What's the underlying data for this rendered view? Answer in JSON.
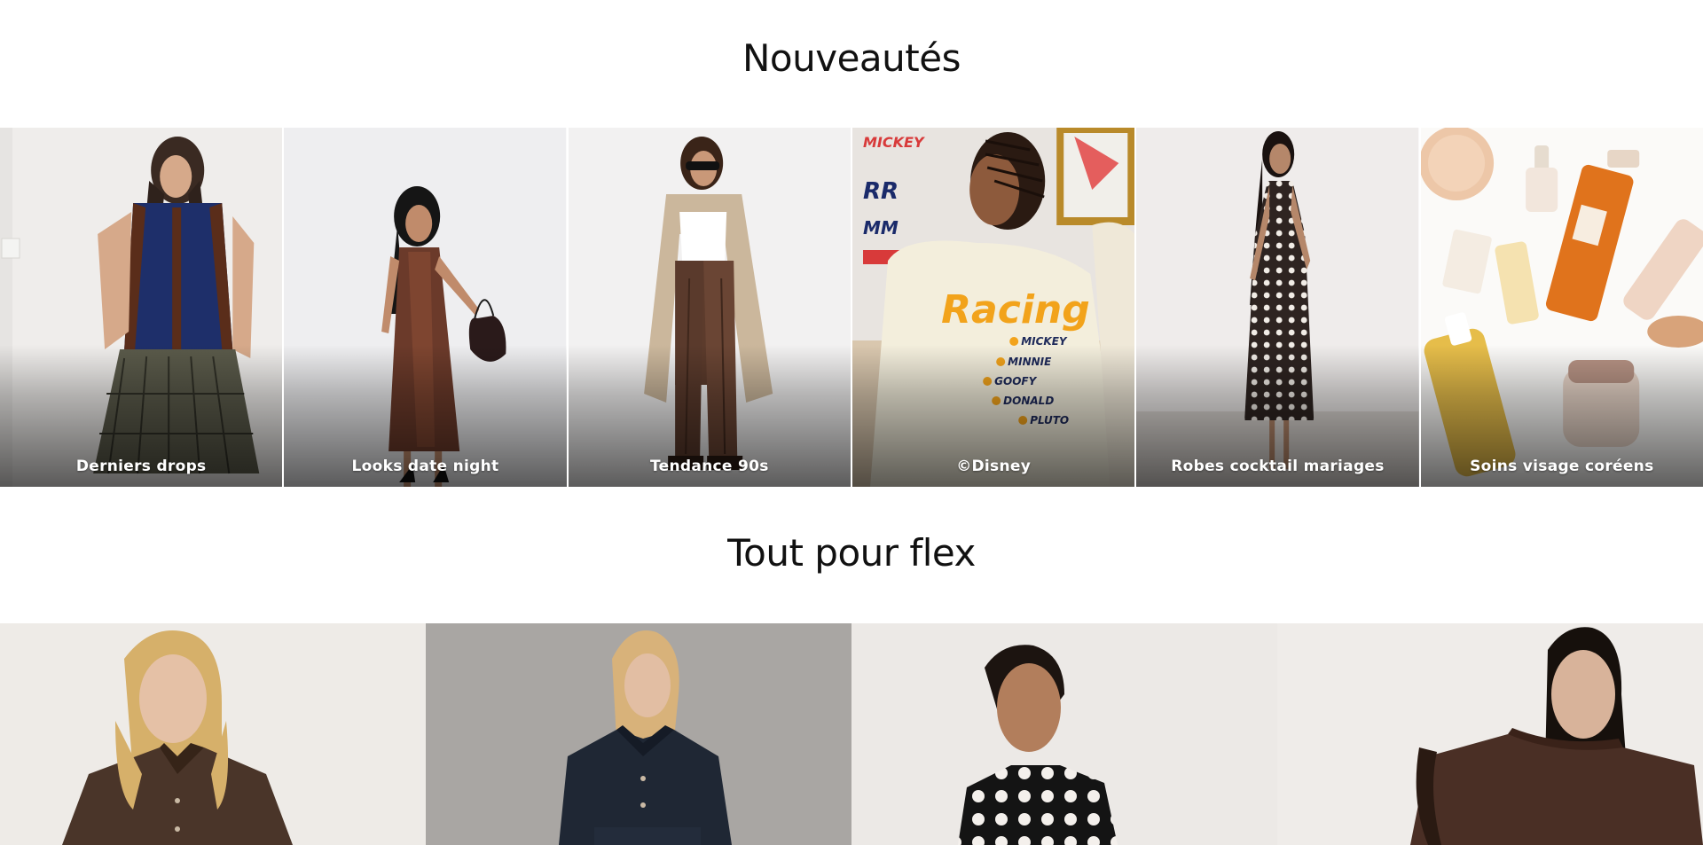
{
  "sections": {
    "new_title": "Nouveautés",
    "flex_title": "Tout pour flex"
  },
  "new_tiles": [
    {
      "label": "Derniers drops"
    },
    {
      "label": "Looks date night"
    },
    {
      "label": "Tendance 90s"
    },
    {
      "label": "©Disney"
    },
    {
      "label": "Robes cocktail mariages"
    },
    {
      "label": "Soins visage coréens"
    }
  ],
  "flex_tiles": [
    {
      "name": "tile-chocolate-denim-shirt"
    },
    {
      "name": "tile-dark-denim-set"
    },
    {
      "name": "tile-polka-dot-top"
    },
    {
      "name": "tile-brown-sweatshirt"
    }
  ],
  "colors": {
    "tile_label": "#ffffff",
    "page_bg": "#ffffff",
    "title_text": "#111111"
  }
}
